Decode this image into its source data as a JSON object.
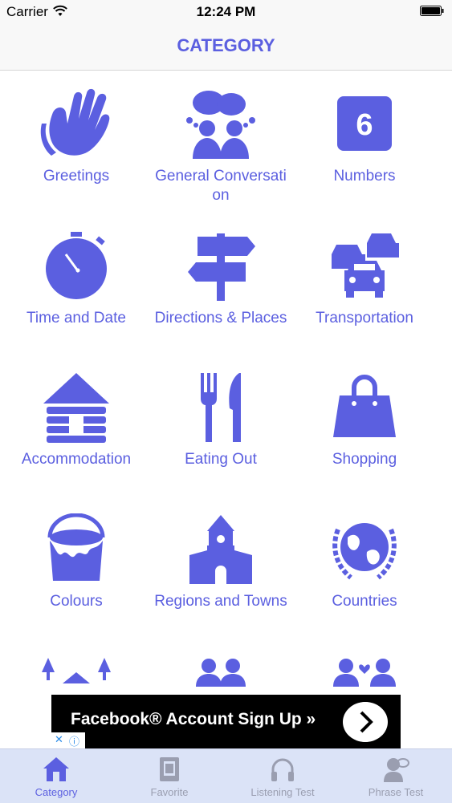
{
  "status_bar": {
    "carrier": "Carrier",
    "time": "12:24 PM"
  },
  "nav": {
    "title": "CATEGORY"
  },
  "colors": {
    "accent": "#5b5fe0",
    "tab_inactive": "#9a9eb0",
    "tabbar_bg": "#dbe3f7"
  },
  "categories": [
    {
      "label": "Greetings",
      "icon": "clapping-hands-icon"
    },
    {
      "label": "General Conversation",
      "icon": "conversation-icon"
    },
    {
      "label": "Numbers",
      "icon": "number-six-icon"
    },
    {
      "label": "Time and Date",
      "icon": "stopwatch-icon"
    },
    {
      "label": "Directions & Places",
      "icon": "signpost-icon"
    },
    {
      "label": "Transportation",
      "icon": "cars-icon"
    },
    {
      "label": "Accommodation",
      "icon": "log-cabin-icon"
    },
    {
      "label": "Eating Out",
      "icon": "fork-knife-icon"
    },
    {
      "label": "Shopping",
      "icon": "shopping-bag-icon"
    },
    {
      "label": "Colours",
      "icon": "paint-bucket-icon"
    },
    {
      "label": "Regions and Towns",
      "icon": "church-icon"
    },
    {
      "label": "Countries",
      "icon": "globe-laurel-icon"
    },
    {
      "label": "",
      "icon": "trees-icon"
    },
    {
      "label": "",
      "icon": "people-icon"
    },
    {
      "label": "",
      "icon": "couple-heart-icon"
    }
  ],
  "ad": {
    "text": "Facebook® Account Sign Up »",
    "close": "✕",
    "info": "ⓘ"
  },
  "tabs": [
    {
      "label": "Category",
      "icon": "home-icon",
      "active": true
    },
    {
      "label": "Favorite",
      "icon": "book-icon",
      "active": false
    },
    {
      "label": "Listening Test",
      "icon": "headphones-icon",
      "active": false
    },
    {
      "label": "Phrase Test",
      "icon": "person-speech-icon",
      "active": false
    }
  ]
}
